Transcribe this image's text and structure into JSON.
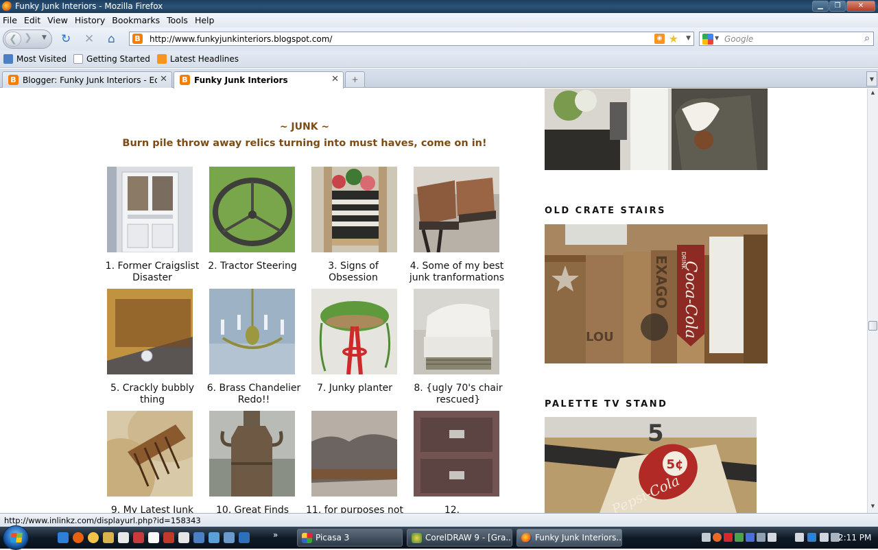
{
  "window": {
    "title": "Funky Junk Interiors - Mozilla Firefox"
  },
  "menu": [
    "File",
    "Edit",
    "View",
    "History",
    "Bookmarks",
    "Tools",
    "Help"
  ],
  "nav": {
    "url": "http://www.funkyjunkinteriors.blogspot.com/",
    "search_placeholder": "Google"
  },
  "bookmarks": [
    {
      "label": "Most Visited",
      "icon": "most-visited-icon"
    },
    {
      "label": "Getting Started",
      "icon": "page-icon"
    },
    {
      "label": "Latest Headlines",
      "icon": "rss-icon"
    }
  ],
  "tabs": [
    {
      "label": "Blogger: Funky Junk Interiors - Edit ...",
      "active": false
    },
    {
      "label": "Funky Junk Interiors",
      "active": true
    }
  ],
  "page": {
    "junk_title": "~ JUNK ~",
    "junk_subtitle": "Burn pile throw away relics turning into must haves, come on in!",
    "items": [
      {
        "c1": "1. Former Craigslist",
        "c2": "Disaster"
      },
      {
        "c1": "2. Tractor Steering",
        "c2": ""
      },
      {
        "c1": "3. Signs of",
        "c2": "Obsession"
      },
      {
        "c1": "4. Some of my best",
        "c2": "junk tranformations"
      },
      {
        "c1": "5. Crackly bubbly",
        "c2": "thing"
      },
      {
        "c1": "6. Brass Chandelier",
        "c2": "Redo!!"
      },
      {
        "c1": "7. Junky planter",
        "c2": ""
      },
      {
        "c1": "8. {ugly 70's chair",
        "c2": "rescued}"
      },
      {
        "c1": "9. My Latest Junk",
        "c2": ""
      },
      {
        "c1": "10. Great Finds",
        "c2": ""
      },
      {
        "c1": "11. for purposes not",
        "c2": ""
      },
      {
        "c1": "12.",
        "c2": ""
      }
    ],
    "sidebar": [
      {
        "heading": "OLD CRATE STAIRS"
      },
      {
        "heading": "PALETTE TV STAND"
      }
    ],
    "crate_text": {
      "exago": "EXAGO",
      "coke": "Coca-Cola",
      "drink": "DRINK",
      "lou": "LOU"
    },
    "pepsi_text": {
      "price": "5¢",
      "brand": "Pepsi-Cola"
    }
  },
  "status": {
    "text": "http://www.inlinkz.com/displayurl.php?id=158343"
  },
  "taskbar": {
    "tasks": [
      {
        "label": "Picasa 3"
      },
      {
        "label": "CorelDRAW 9 - [Gra..."
      },
      {
        "label": "Funky Junk Interiors..."
      }
    ],
    "clock": "2:11 PM"
  },
  "colors": {
    "heading_brown": "#7d4b14",
    "blogger_orange": "#f57d00"
  }
}
